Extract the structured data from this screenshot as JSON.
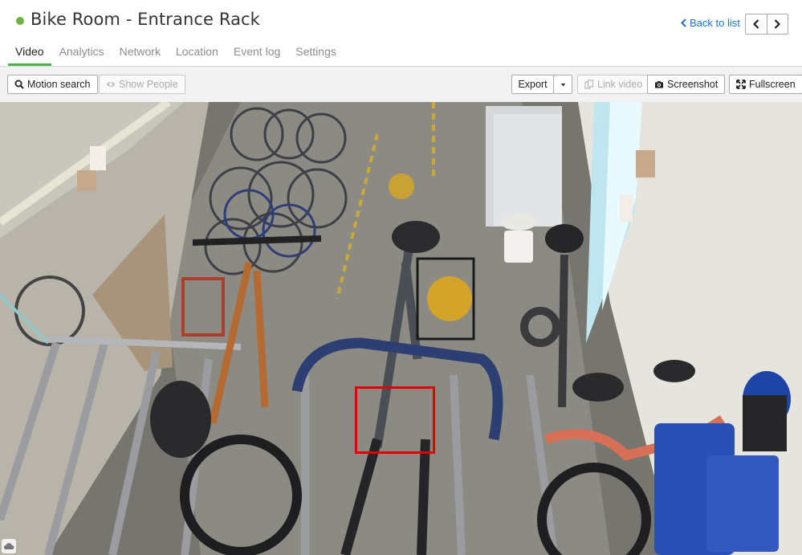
{
  "header": {
    "title": "Bike Room - Entrance Rack",
    "status_color": "#6cb33e",
    "back_label": "Back to list",
    "back_icon": "chevron-left-icon",
    "prev_icon": "chevron-left-icon",
    "next_icon": "chevron-right-icon"
  },
  "tabs": [
    {
      "label": "Video",
      "active": true
    },
    {
      "label": "Analytics"
    },
    {
      "label": "Network"
    },
    {
      "label": "Location"
    },
    {
      "label": "Event log"
    },
    {
      "label": "Settings"
    }
  ],
  "toolbar": {
    "motion_search": "Motion search",
    "show_people": "Show People",
    "export": "Export",
    "link_video": "Link video",
    "screenshot": "Screenshot",
    "fullscreen": "Fullscreen"
  },
  "colors": {
    "accent": "#4caf50",
    "link": "#1a73c8",
    "detection_box": "#e30000"
  }
}
